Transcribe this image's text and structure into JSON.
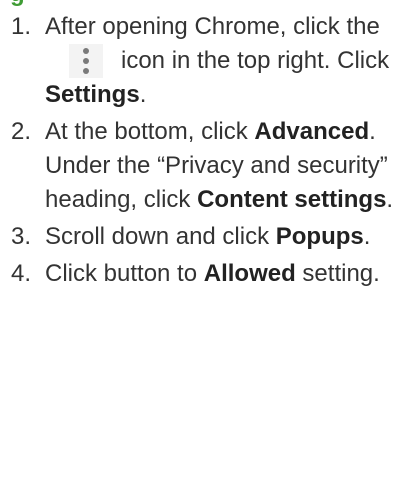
{
  "colors": {
    "text": "#333333",
    "heading_green": "#3f9c35",
    "icon_bg": "#f3f3f3",
    "icon_dots": "#7a7a7a"
  },
  "steps": [
    {
      "number": "1.",
      "part1": "After opening Chrome, click the",
      "icon": "more-vertical-icon",
      "part2": "icon in the top right. Click ",
      "bold1": "Settings",
      "part3": "."
    },
    {
      "number": "2.",
      "part1": "At the bottom, click ",
      "bold1": "Advanced",
      "part2": ". Under the “Privacy and security” heading, click ",
      "bold2": "Content settings",
      "part3": "."
    },
    {
      "number": "3.",
      "part1": "Scroll down and click ",
      "bold1": "Popups",
      "part2": "."
    },
    {
      "number": "4.",
      "part1": "Click button to ",
      "bold1": "Allowed",
      "part2": " setting."
    }
  ]
}
